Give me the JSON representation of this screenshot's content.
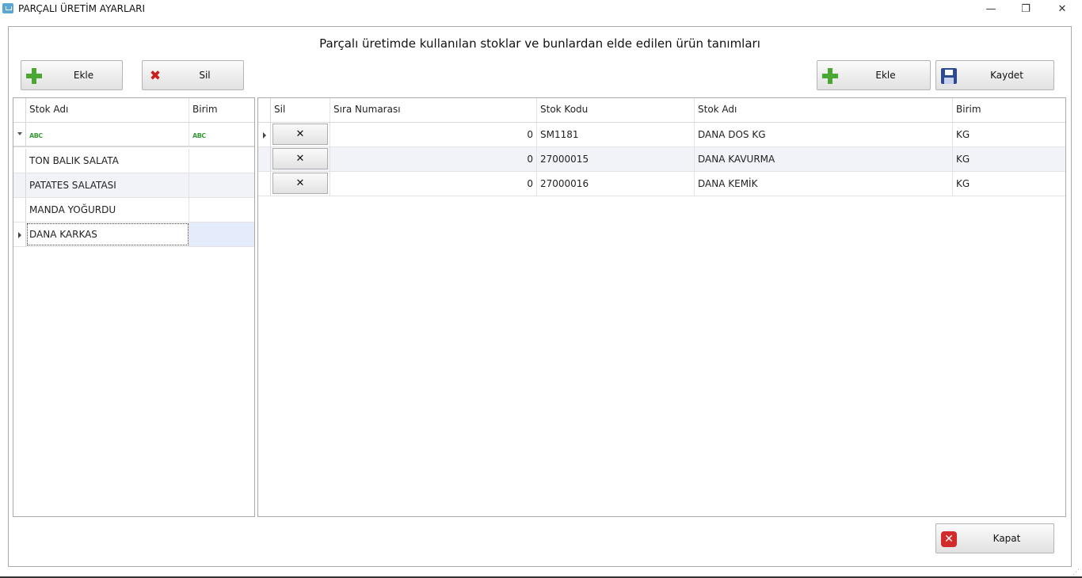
{
  "window": {
    "title": "PARÇALI ÜRETİM AYARLARI",
    "minimize": "—",
    "maximize": "❐",
    "close": "✕"
  },
  "header": {
    "title": "Parçalı üretimde kullanılan stoklar ve bunlardan elde edilen ürün tanımları"
  },
  "left_toolbar": {
    "add_label": "Ekle",
    "delete_label": "Sil"
  },
  "right_toolbar": {
    "add_label": "Ekle",
    "save_label": "Kaydet"
  },
  "left_grid": {
    "columns": [
      "Stok Adı",
      "Birim"
    ],
    "filter_icon": "abc-filter-icon",
    "rows": [
      {
        "stok_adi": "TON BALIK SALATA",
        "birim": ""
      },
      {
        "stok_adi": "PATATES SALATASI",
        "birim": ""
      },
      {
        "stok_adi": "MANDA YOĞURDU",
        "birim": ""
      },
      {
        "stok_adi": "DANA KARKAS",
        "birim": ""
      }
    ]
  },
  "right_grid": {
    "columns": [
      "Sil",
      "Sıra Numarası",
      "Stok Kodu",
      "Stok Adı",
      "Birim"
    ],
    "delete_glyph": "✕",
    "rows": [
      {
        "sira": "0",
        "stok_kodu": "SM1181",
        "stok_adi": "DANA DOS KG",
        "birim": "KG"
      },
      {
        "sira": "0",
        "stok_kodu": "27000015",
        "stok_adi": "DANA KAVURMA",
        "birim": "KG"
      },
      {
        "sira": "0",
        "stok_kodu": "27000016",
        "stok_adi": "DANA KEMİK",
        "birim": "KG"
      }
    ]
  },
  "footer": {
    "close_label": "Kapat"
  },
  "colors": {
    "add_green": "#4aa832",
    "delete_red": "#c81e1e",
    "save_blue": "#2d4a91",
    "selection": "#e4ebfb"
  }
}
